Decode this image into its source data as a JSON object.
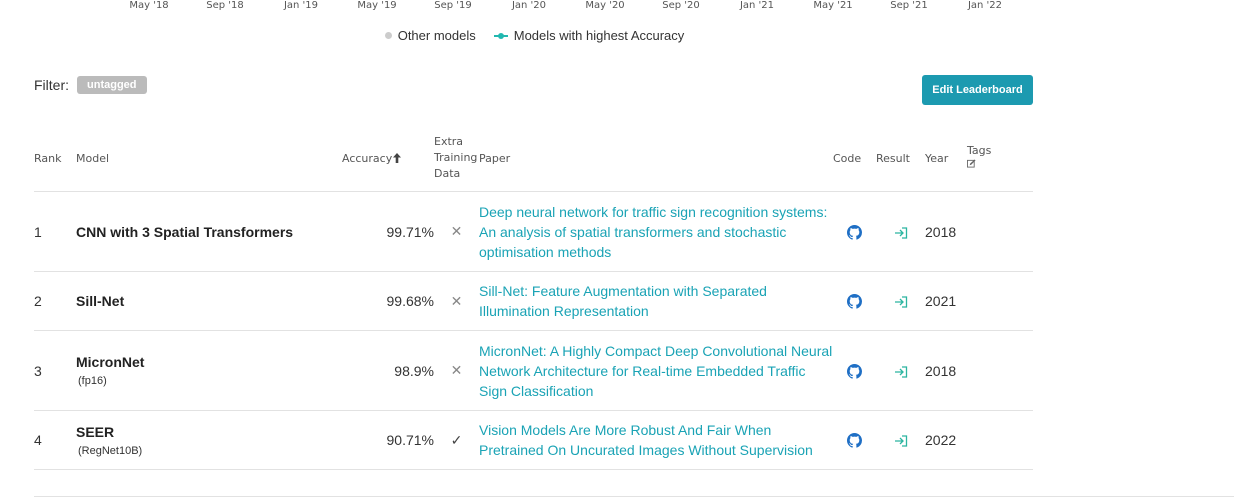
{
  "axis_ticks": [
    "May '18",
    "Sep '18",
    "Jan '19",
    "May '19",
    "Sep '19",
    "Jan '20",
    "May '20",
    "Sep '20",
    "Jan '21",
    "May '21",
    "Sep '21",
    "Jan '22"
  ],
  "legend": {
    "other_label": "Other models",
    "highest_label": "Models with highest Accuracy"
  },
  "filter": {
    "label": "Filter:",
    "tag": "untagged"
  },
  "edit_button": "Edit Leaderboard",
  "table": {
    "headers": {
      "rank": "Rank",
      "model": "Model",
      "accuracy": "Accuracy",
      "extra_line1": "Extra",
      "extra_line2": "Training",
      "extra_line3": "Data",
      "paper": "Paper",
      "code": "Code",
      "result": "Result",
      "year": "Year",
      "tags": "Tags"
    },
    "rows": [
      {
        "rank": "1",
        "model": "CNN with 3 Spatial Transformers",
        "model_sub": "",
        "accuracy": "99.71%",
        "extra": "✕",
        "paper": "Deep neural network for traffic sign recognition systems: An analysis of spatial transformers and stochastic optimisation methods",
        "year": "2018"
      },
      {
        "rank": "2",
        "model": "Sill-Net",
        "model_sub": "",
        "accuracy": "99.68%",
        "extra": "✕",
        "paper": "Sill-Net: Feature Augmentation with Separated Illumination Representation",
        "year": "2021"
      },
      {
        "rank": "3",
        "model": "MicronNet",
        "model_sub": "(fp16)",
        "accuracy": "98.9%",
        "extra": "✕",
        "paper": "MicronNet: A Highly Compact Deep Convolutional Neural Network Architecture for Real-time Embedded Traffic Sign Classification",
        "year": "2018"
      },
      {
        "rank": "4",
        "model": "SEER",
        "model_sub": "(RegNet10B)",
        "accuracy": "90.71%",
        "extra": "✓",
        "paper": "Vision Models Are More Robust And Fair When Pretrained On Uncurated Images Without Supervision",
        "year": "2022"
      }
    ]
  },
  "colors": {
    "accent": "#1c9ab0",
    "link": "#1aa3b5",
    "highlight_series": "#21b8b0",
    "other_series": "#cccccc",
    "github_icon": "#1f6fc5",
    "result_icon": "#2bb5a0"
  },
  "icons": {
    "code": "github-icon",
    "result": "result-arrow-icon",
    "tags": "edit-tags-icon",
    "sort": "sort-up-arrow-icon"
  }
}
